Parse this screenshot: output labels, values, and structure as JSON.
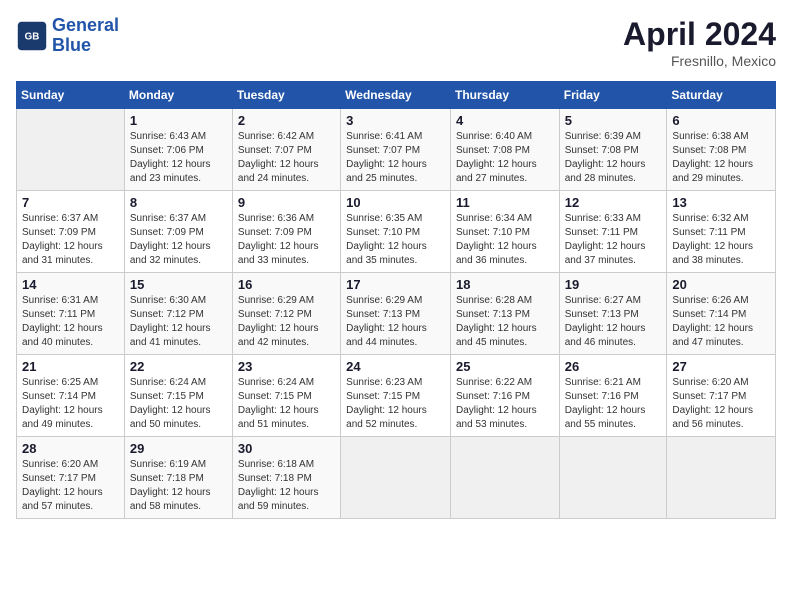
{
  "header": {
    "logo_line1": "General",
    "logo_line2": "Blue",
    "month_year": "April 2024",
    "location": "Fresnillo, Mexico"
  },
  "days_of_week": [
    "Sunday",
    "Monday",
    "Tuesday",
    "Wednesday",
    "Thursday",
    "Friday",
    "Saturday"
  ],
  "weeks": [
    [
      {
        "day": "",
        "sunrise": "",
        "sunset": "",
        "daylight": ""
      },
      {
        "day": "1",
        "sunrise": "6:43 AM",
        "sunset": "7:06 PM",
        "daylight": "12 hours and 23 minutes."
      },
      {
        "day": "2",
        "sunrise": "6:42 AM",
        "sunset": "7:07 PM",
        "daylight": "12 hours and 24 minutes."
      },
      {
        "day": "3",
        "sunrise": "6:41 AM",
        "sunset": "7:07 PM",
        "daylight": "12 hours and 25 minutes."
      },
      {
        "day": "4",
        "sunrise": "6:40 AM",
        "sunset": "7:08 PM",
        "daylight": "12 hours and 27 minutes."
      },
      {
        "day": "5",
        "sunrise": "6:39 AM",
        "sunset": "7:08 PM",
        "daylight": "12 hours and 28 minutes."
      },
      {
        "day": "6",
        "sunrise": "6:38 AM",
        "sunset": "7:08 PM",
        "daylight": "12 hours and 29 minutes."
      }
    ],
    [
      {
        "day": "7",
        "sunrise": "6:37 AM",
        "sunset": "7:09 PM",
        "daylight": "12 hours and 31 minutes."
      },
      {
        "day": "8",
        "sunrise": "6:37 AM",
        "sunset": "7:09 PM",
        "daylight": "12 hours and 32 minutes."
      },
      {
        "day": "9",
        "sunrise": "6:36 AM",
        "sunset": "7:09 PM",
        "daylight": "12 hours and 33 minutes."
      },
      {
        "day": "10",
        "sunrise": "6:35 AM",
        "sunset": "7:10 PM",
        "daylight": "12 hours and 35 minutes."
      },
      {
        "day": "11",
        "sunrise": "6:34 AM",
        "sunset": "7:10 PM",
        "daylight": "12 hours and 36 minutes."
      },
      {
        "day": "12",
        "sunrise": "6:33 AM",
        "sunset": "7:11 PM",
        "daylight": "12 hours and 37 minutes."
      },
      {
        "day": "13",
        "sunrise": "6:32 AM",
        "sunset": "7:11 PM",
        "daylight": "12 hours and 38 minutes."
      }
    ],
    [
      {
        "day": "14",
        "sunrise": "6:31 AM",
        "sunset": "7:11 PM",
        "daylight": "12 hours and 40 minutes."
      },
      {
        "day": "15",
        "sunrise": "6:30 AM",
        "sunset": "7:12 PM",
        "daylight": "12 hours and 41 minutes."
      },
      {
        "day": "16",
        "sunrise": "6:29 AM",
        "sunset": "7:12 PM",
        "daylight": "12 hours and 42 minutes."
      },
      {
        "day": "17",
        "sunrise": "6:29 AM",
        "sunset": "7:13 PM",
        "daylight": "12 hours and 44 minutes."
      },
      {
        "day": "18",
        "sunrise": "6:28 AM",
        "sunset": "7:13 PM",
        "daylight": "12 hours and 45 minutes."
      },
      {
        "day": "19",
        "sunrise": "6:27 AM",
        "sunset": "7:13 PM",
        "daylight": "12 hours and 46 minutes."
      },
      {
        "day": "20",
        "sunrise": "6:26 AM",
        "sunset": "7:14 PM",
        "daylight": "12 hours and 47 minutes."
      }
    ],
    [
      {
        "day": "21",
        "sunrise": "6:25 AM",
        "sunset": "7:14 PM",
        "daylight": "12 hours and 49 minutes."
      },
      {
        "day": "22",
        "sunrise": "6:24 AM",
        "sunset": "7:15 PM",
        "daylight": "12 hours and 50 minutes."
      },
      {
        "day": "23",
        "sunrise": "6:24 AM",
        "sunset": "7:15 PM",
        "daylight": "12 hours and 51 minutes."
      },
      {
        "day": "24",
        "sunrise": "6:23 AM",
        "sunset": "7:15 PM",
        "daylight": "12 hours and 52 minutes."
      },
      {
        "day": "25",
        "sunrise": "6:22 AM",
        "sunset": "7:16 PM",
        "daylight": "12 hours and 53 minutes."
      },
      {
        "day": "26",
        "sunrise": "6:21 AM",
        "sunset": "7:16 PM",
        "daylight": "12 hours and 55 minutes."
      },
      {
        "day": "27",
        "sunrise": "6:20 AM",
        "sunset": "7:17 PM",
        "daylight": "12 hours and 56 minutes."
      }
    ],
    [
      {
        "day": "28",
        "sunrise": "6:20 AM",
        "sunset": "7:17 PM",
        "daylight": "12 hours and 57 minutes."
      },
      {
        "day": "29",
        "sunrise": "6:19 AM",
        "sunset": "7:18 PM",
        "daylight": "12 hours and 58 minutes."
      },
      {
        "day": "30",
        "sunrise": "6:18 AM",
        "sunset": "7:18 PM",
        "daylight": "12 hours and 59 minutes."
      },
      {
        "day": "",
        "sunrise": "",
        "sunset": "",
        "daylight": ""
      },
      {
        "day": "",
        "sunrise": "",
        "sunset": "",
        "daylight": ""
      },
      {
        "day": "",
        "sunrise": "",
        "sunset": "",
        "daylight": ""
      },
      {
        "day": "",
        "sunrise": "",
        "sunset": "",
        "daylight": ""
      }
    ]
  ]
}
